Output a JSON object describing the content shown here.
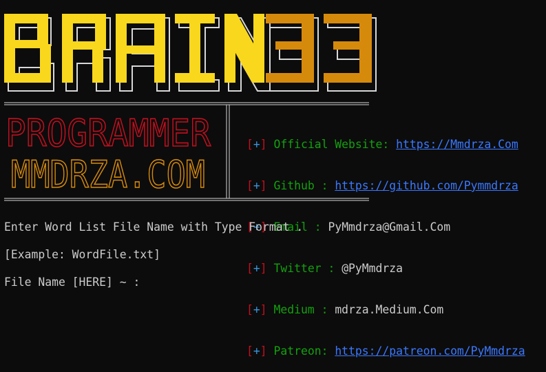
{
  "banner": {
    "word1": "BRAIN",
    "word2": "33",
    "logo_line1": "PROGRAMMER",
    "logo_line2": "MMDRZA.COM",
    "colors": {
      "word1": "#f9d71c",
      "word2": "#d68a0c",
      "outline": "#d8d8d8",
      "logo_line1": "#c50f1f",
      "logo_line2": "#d68a0c"
    }
  },
  "info": [
    {
      "bracket_open": "[",
      "plus": "+",
      "bracket_close": "]",
      "label": "Official Website: ",
      "value": "https://Mmdrza.Com",
      "link": true
    },
    {
      "bracket_open": "[",
      "plus": "+",
      "bracket_close": "]",
      "label": "Github : ",
      "value": "https://github.com/Pymmdrza",
      "link": true
    },
    {
      "bracket_open": "[",
      "plus": "+",
      "bracket_close": "]",
      "label": "Email : ",
      "value": "PyMmdrza@Gmail.Com",
      "link": false
    },
    {
      "bracket_open": "[",
      "plus": "+",
      "bracket_close": "]",
      "label": "Twitter : ",
      "value": "@PyMmdrza",
      "link": false
    },
    {
      "bracket_open": "[",
      "plus": "+",
      "bracket_close": "]",
      "label": "Medium : ",
      "value": "mdrza.Medium.Com",
      "link": false
    },
    {
      "bracket_open": "[",
      "plus": "+",
      "bracket_close": "]",
      "label": "Patreon: ",
      "value": "https://patreon.com/PyMmdrza",
      "link": true
    }
  ],
  "prompt": {
    "line1": "Enter Word List File Name with Type Format .",
    "line2": "[Example: WordFile.txt]",
    "line3": "File Name [HERE] ~ : "
  }
}
